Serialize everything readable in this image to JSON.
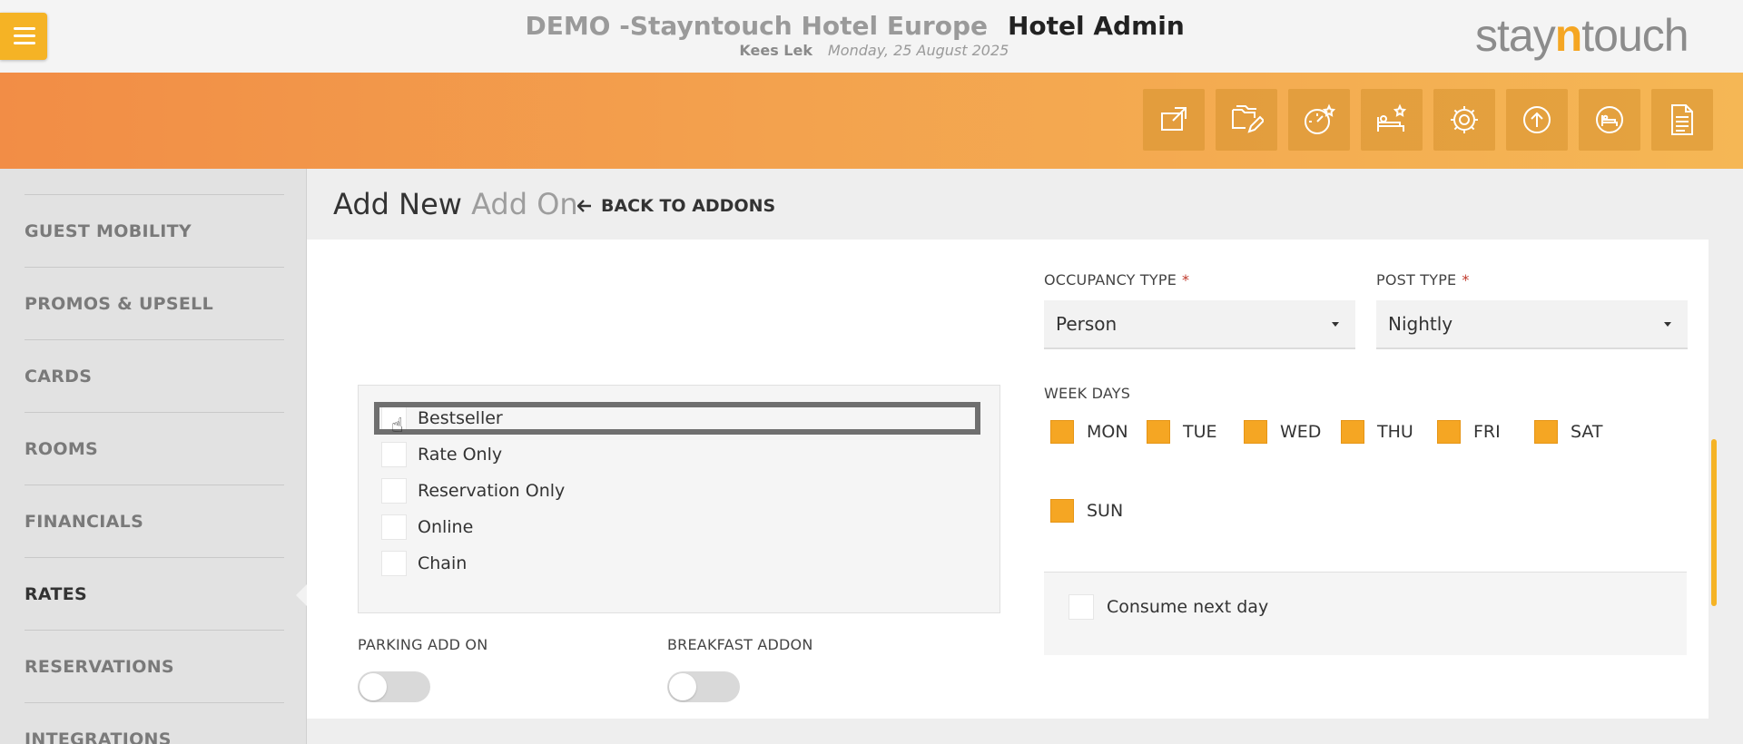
{
  "header": {
    "hotel_name": "DEMO -Stayntouch Hotel Europe",
    "app_title": "Hotel Admin",
    "user_name": "Kees Lek",
    "date": "Monday, 25 August 2025",
    "logo_prefix": "stay",
    "logo_n": "n",
    "logo_suffix": "touch"
  },
  "toolbar": {
    "icons": [
      "external-link-icon",
      "folder-edit-icon",
      "dashboard-star-icon",
      "bed-star-icon",
      "gear-icon",
      "upload-circle-icon",
      "bed-circle-icon",
      "document-icon"
    ]
  },
  "sidebar": {
    "items": [
      {
        "label": "GUEST MOBILITY"
      },
      {
        "label": "PROMOS & UPSELL"
      },
      {
        "label": "CARDS"
      },
      {
        "label": "ROOMS"
      },
      {
        "label": "FINANCIALS"
      },
      {
        "label": "RATES"
      },
      {
        "label": "RESERVATIONS"
      },
      {
        "label": "INTEGRATIONS"
      }
    ],
    "active": "RATES"
  },
  "page": {
    "title_main": "Add New",
    "title_sub": "Add On",
    "back_label": "BACK TO ADDONS"
  },
  "form": {
    "occupancy_type": {
      "label": "OCCUPANCY TYPE",
      "required": "*",
      "value": "Person"
    },
    "post_type": {
      "label": "POST TYPE",
      "required": "*",
      "value": "Nightly"
    },
    "flags": [
      {
        "label": "Bestseller"
      },
      {
        "label": "Rate Only"
      },
      {
        "label": "Reservation Only"
      },
      {
        "label": "Online"
      },
      {
        "label": "Chain"
      }
    ],
    "week_days_label": "WEEK DAYS",
    "week_days": [
      "MON",
      "TUE",
      "WED",
      "THU",
      "FRI",
      "SAT",
      "SUN"
    ],
    "parking_label": "PARKING ADD ON",
    "breakfast_label": "BREAKFAST ADDON",
    "consume_label": "Consume next day"
  },
  "colors": {
    "accent": "#f5a623",
    "menu_button": "#f5b325",
    "band_start": "#f28d46",
    "band_end": "#f5b755"
  }
}
